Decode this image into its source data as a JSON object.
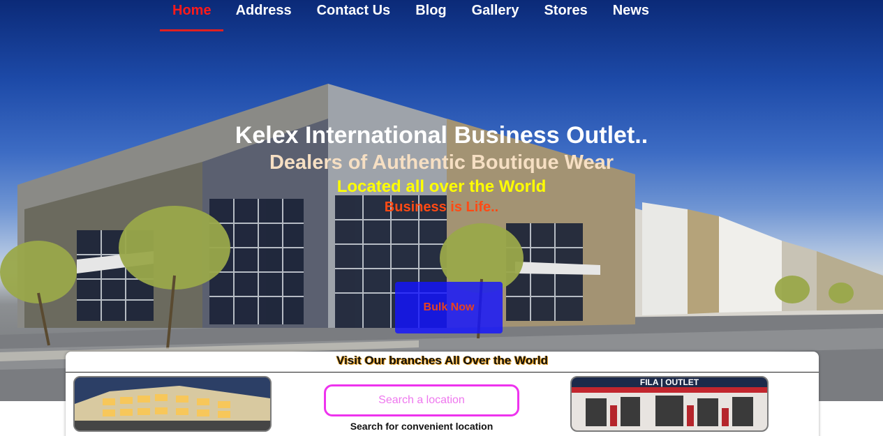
{
  "nav": {
    "items": [
      {
        "label": "Home",
        "active": true
      },
      {
        "label": "Address",
        "active": false
      },
      {
        "label": "Contact Us",
        "active": false
      },
      {
        "label": "Blog",
        "active": false
      },
      {
        "label": "Gallery",
        "active": false
      },
      {
        "label": "Stores",
        "active": false
      },
      {
        "label": "News",
        "active": false
      }
    ],
    "active_color": "#ff1a1a"
  },
  "hero": {
    "title": "Kelex International Business Outlet..",
    "subtitle": "Dealers of Authentic Boutique Wear",
    "tagline": "Located all over the World",
    "motto": "Business is Life..",
    "cta_label": "Bulk Now",
    "cta_color": "#1414ff"
  },
  "branches": {
    "title": "Visit Our branches All Over the World",
    "search_placeholder": "Search a location",
    "search_caption": "Search for convenient location",
    "left_image": "modern-building-night-photo",
    "right_image": "fila-outlet-storefront-photo",
    "right_sign_text": "FILA | OUTLET"
  }
}
